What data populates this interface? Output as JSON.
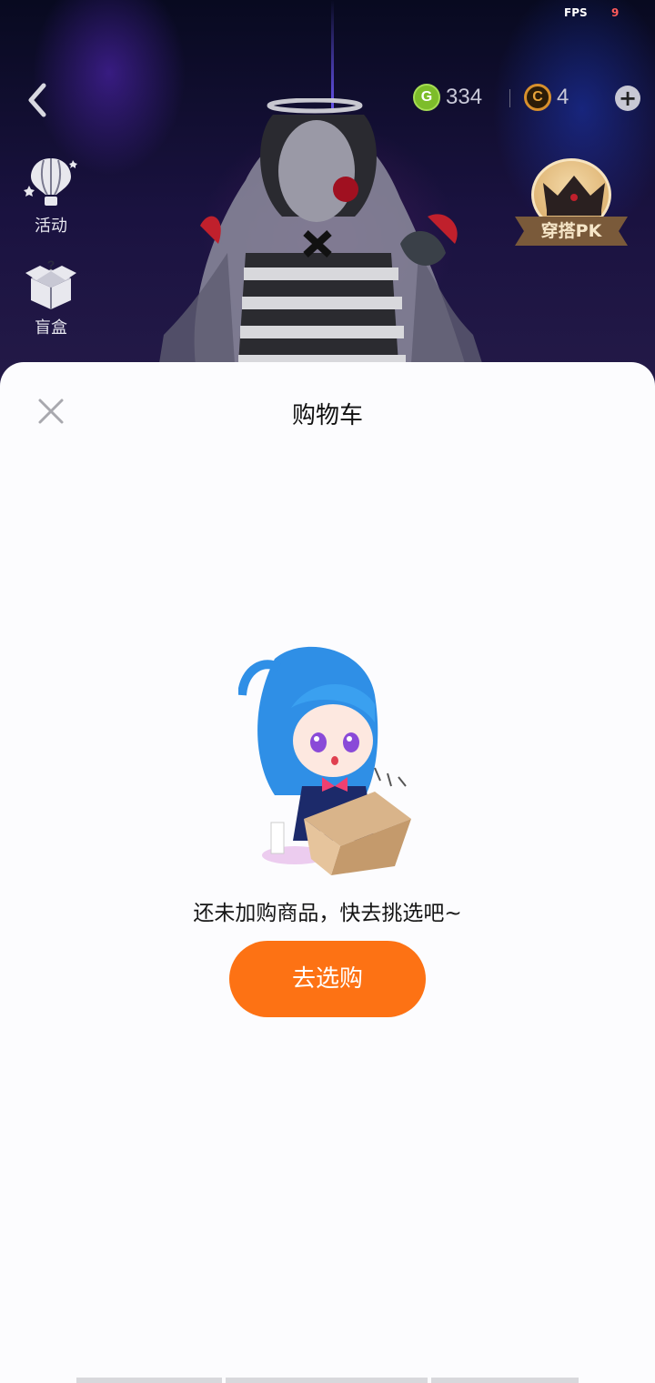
{
  "status": {
    "fps_label": "FPS",
    "fps_value": "9"
  },
  "header": {
    "coins": [
      {
        "icon": "g-coin-icon",
        "letter": "G",
        "value": "334",
        "color": "#7dbd2a"
      },
      {
        "icon": "c-coin-icon",
        "letter": "C",
        "value": "4",
        "color": "#d8902c"
      }
    ]
  },
  "side_menu": [
    {
      "label": "活动",
      "icon": "hot-air-balloon-icon"
    },
    {
      "label": "盲盒",
      "icon": "blind-box-icon"
    }
  ],
  "pk_badge": {
    "label": "穿搭PK",
    "icon": "crown-icon"
  },
  "cart": {
    "title": "购物车",
    "empty_message": "还未加购商品，快去挑选吧~",
    "cta_label": "去选购"
  },
  "colors": {
    "accent": "#fd7214",
    "sheet_bg": "#fcfcfe"
  }
}
